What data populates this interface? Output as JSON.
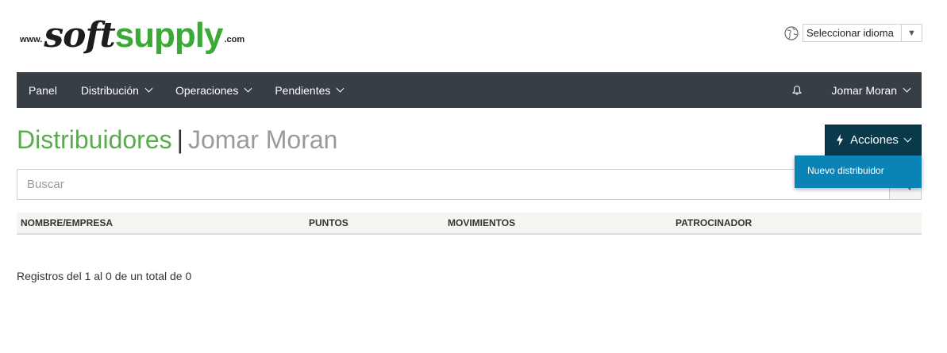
{
  "logo": {
    "prefix": "www.",
    "part1": "soft",
    "part2": "supply",
    "suffix": ".com"
  },
  "language": {
    "icon": "globe-icon",
    "selected": "Seleccionar idioma",
    "arrow": "▼"
  },
  "navbar": {
    "items": [
      {
        "label": "Panel",
        "has_dropdown": false
      },
      {
        "label": "Distribución",
        "has_dropdown": true
      },
      {
        "label": "Operaciones",
        "has_dropdown": true
      },
      {
        "label": "Pendientes",
        "has_dropdown": true
      }
    ],
    "notification_icon": "bell-icon",
    "user": "Jomar Moran"
  },
  "page": {
    "title": "Distribuidores",
    "separator": "|",
    "subtitle": "Jomar Moran"
  },
  "actions": {
    "icon": "bolt-icon",
    "label": "Acciones",
    "menu": [
      "Nuevo distribuidor"
    ]
  },
  "search": {
    "placeholder": "Buscar",
    "value": ""
  },
  "table": {
    "columns": [
      "NOMBRE/EMPRESA",
      "PUNTOS",
      "MOVIMIENTOS",
      "PATROCINADOR"
    ],
    "rows": []
  },
  "pagination": {
    "summary": "Registros del 1 al 0 de un total de 0"
  },
  "colors": {
    "navbar": "#383e45",
    "title": "#5aab4e",
    "actions": "#09394a",
    "dropdown": "#0a84b6",
    "brand_green": "#3aa935"
  }
}
